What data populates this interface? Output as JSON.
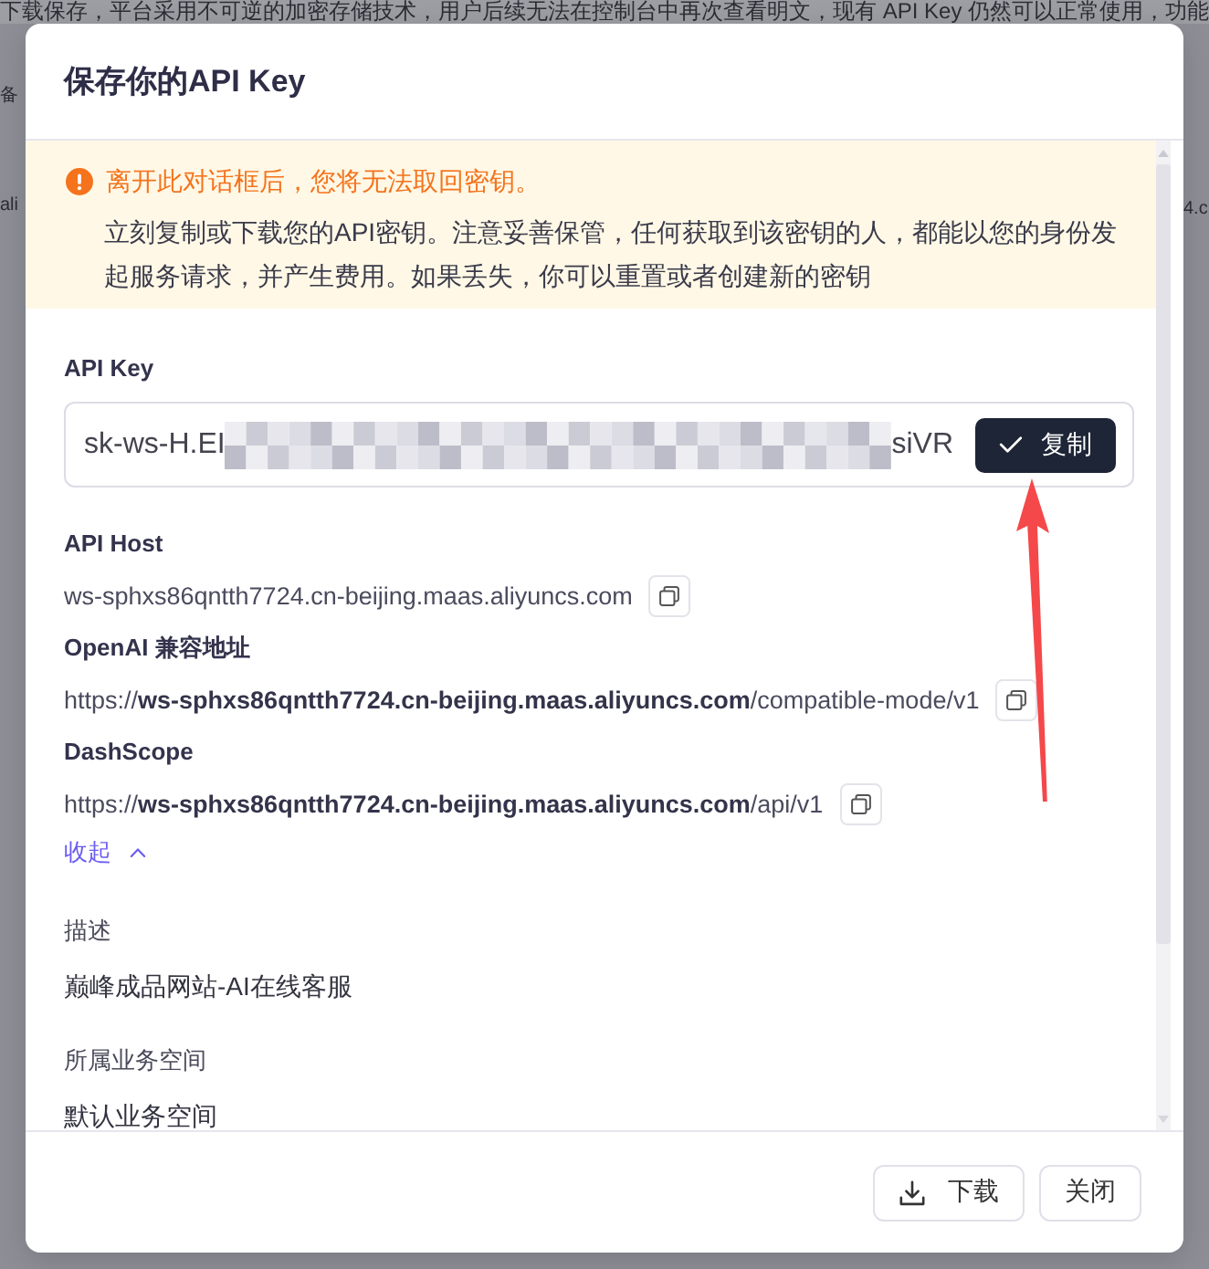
{
  "backdrop": {
    "top_text": "下载保存，平台采用不可逆的加密存储技术，用户后续无法在控制台中再次查看明文，现有 API Key 仍然可以正常使用，功能",
    "left_fragments": [
      "备",
      "ali"
    ],
    "right_fragments": [
      "4.c"
    ]
  },
  "dialog": {
    "title": "保存你的API Key",
    "alert": {
      "kind": "warning",
      "title": "离开此对话框后，您将无法取回密钥。",
      "message": "立刻复制或下载您的API密钥。注意妥善保管，任何获取到该密钥的人，都能以您的身份发起服务请求，并产生费用。如果丢失，你可以重置或者创建新的密钥"
    },
    "api_key": {
      "label": "API Key",
      "segments": [
        {
          "kind": "text",
          "text": "sk-ws-H.EI"
        },
        {
          "kind": "redacted"
        },
        {
          "kind": "text",
          "text": "siVR"
        }
      ],
      "copy_button": "复制"
    },
    "endpoints": [
      {
        "label": "API Host",
        "value": "ws-sphxs86qntth7724.cn-beijing.maas.aliyuncs.com"
      },
      {
        "label": "OpenAI 兼容地址",
        "value": "https://**ws-sphxs86qntth7724.cn-beijing.maas.aliyuncs.com**/compatible-mode/v1"
      },
      {
        "label": "DashScope",
        "value": "https://**ws-sphxs86qntth7724.cn-beijing.maas.aliyuncs.com**/api/v1"
      }
    ],
    "collapse_link": {
      "label": "收起",
      "expanded": true
    },
    "details": [
      {
        "label": "描述",
        "value": "巅峰成品网站-AI在线客服"
      },
      {
        "label": "所属业务空间",
        "value": "默认业务空间"
      }
    ],
    "buttons": [
      {
        "kind": "download",
        "label": "下载"
      },
      {
        "kind": "close",
        "label": "关闭"
      }
    ]
  },
  "annotations": [
    {
      "kind": "arrow"
    }
  ]
}
